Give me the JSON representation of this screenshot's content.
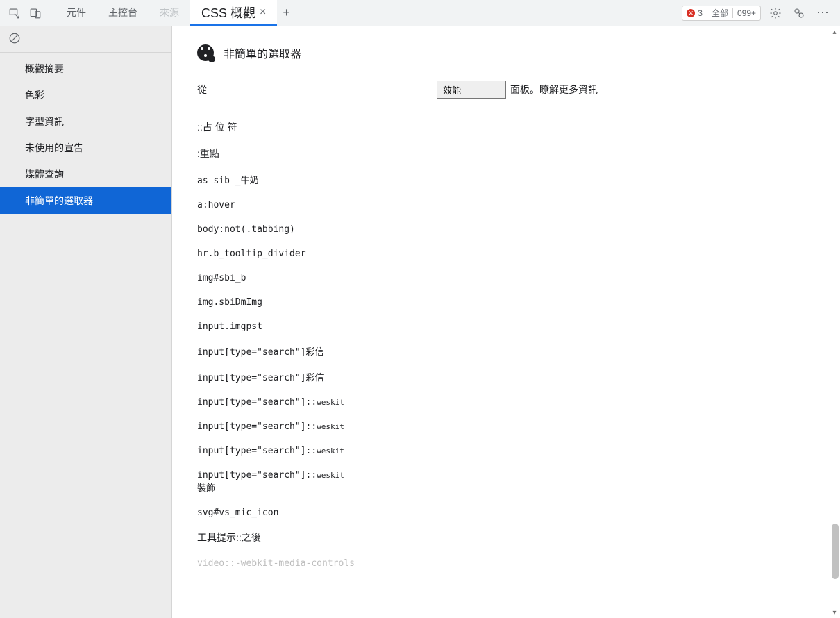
{
  "tabbar": {
    "tabs": [
      {
        "label": "元件"
      },
      {
        "label": "主控台"
      },
      {
        "label": "來源",
        "dim": true
      }
    ],
    "active_tab": {
      "label": "CSS 概觀",
      "close": "×",
      "plus": "+"
    },
    "error_count": "3",
    "all_label": "全部",
    "overflow_count": "099+"
  },
  "sidebar": {
    "items": [
      {
        "label": "概觀摘要"
      },
      {
        "label": "色彩"
      },
      {
        "label": "字型資訊"
      },
      {
        "label": "未使用的宣告"
      },
      {
        "label": "媒體查詢"
      },
      {
        "label": "非簡單的選取器",
        "selected": true
      }
    ]
  },
  "main": {
    "section_title": "非簡單的選取器",
    "hint_from": "從",
    "perf_button": "效能",
    "hint_after": "面板。瞭解更多資訊",
    "selectors": [
      "::占 位 符",
      ":重點",
      "as sib      _牛奶",
      "a:hover",
      "body:not(.tabbing)",
      "hr.b_tooltip_divider",
      "img#sbi_b",
      "img.sbiDmImg",
      "input.imgpst",
      "input[type=\"search\"]彩信",
      "input[type=\"search\"]彩信",
      "input[type=\"search\"]::weskit",
      "input[type=\"search\"]::weskit",
      "input[type=\"search\"]::weskit",
      "input[type=\"search\"]::weskit",
      "裝飾",
      "svg#vs_mic_icon",
      "工具提示::之後",
      "video::-webkit-media-controls"
    ]
  }
}
